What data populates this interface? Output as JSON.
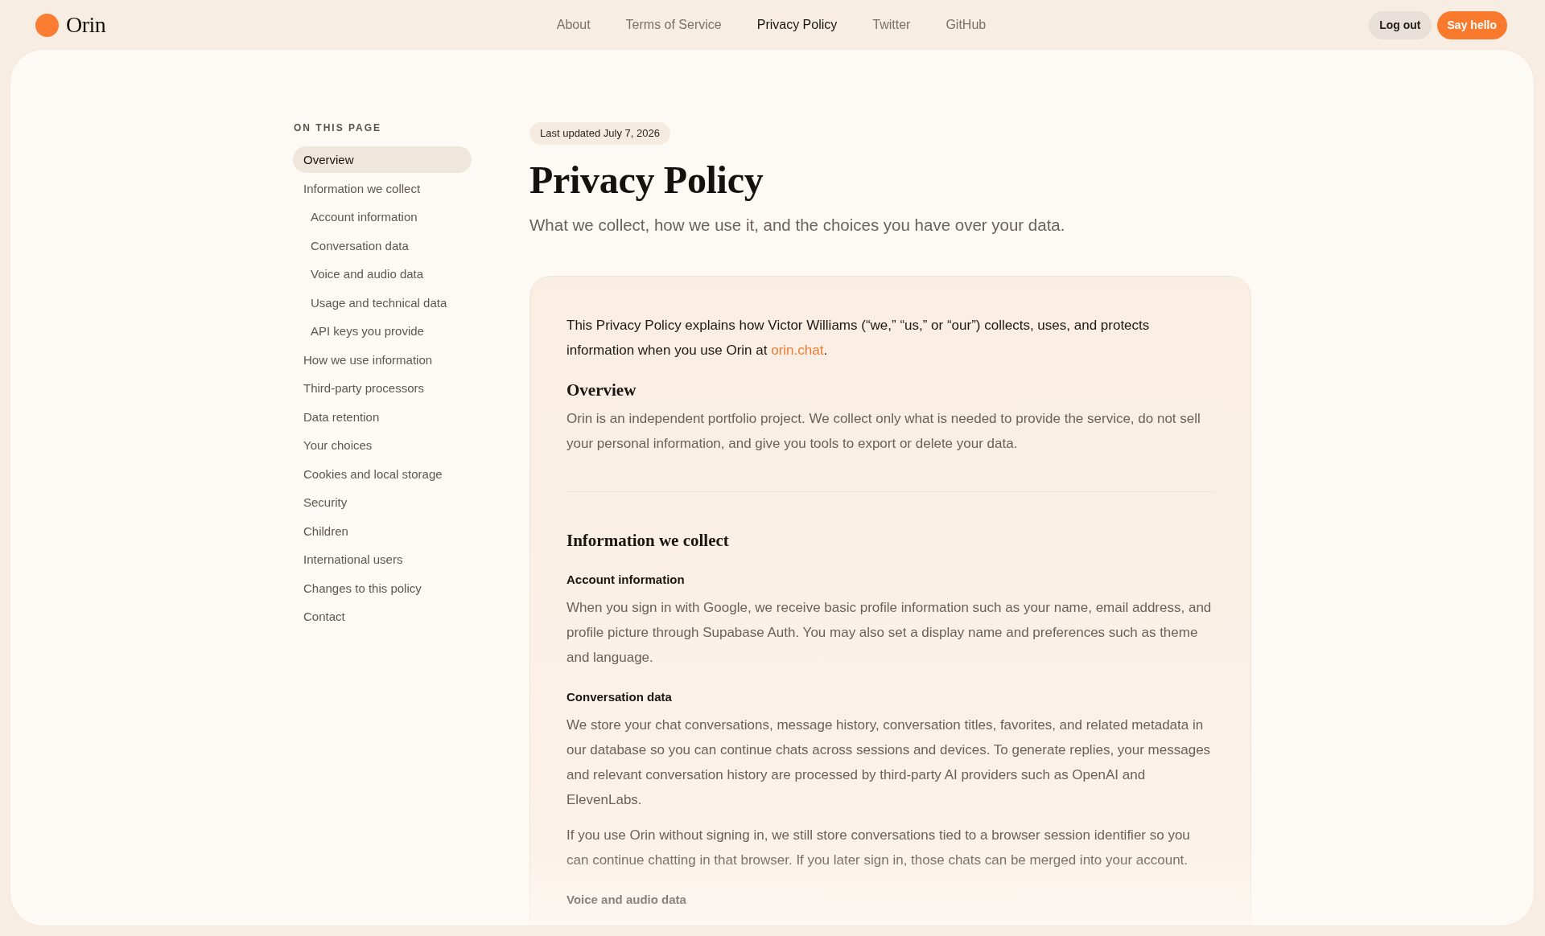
{
  "header": {
    "brand": "Orin",
    "nav": [
      {
        "label": "About",
        "selected": false
      },
      {
        "label": "Terms of Service",
        "selected": false
      },
      {
        "label": "Privacy Policy",
        "selected": true
      },
      {
        "label": "Twitter",
        "selected": false
      },
      {
        "label": "GitHub",
        "selected": false
      }
    ],
    "buttons": [
      {
        "label": "Log out",
        "kind": "secondary"
      },
      {
        "label": "Say hello",
        "kind": "primary"
      }
    ]
  },
  "toc": {
    "title": "ON THIS PAGE",
    "items": [
      {
        "label": "Overview",
        "selected": true
      },
      {
        "label": "Information we collect",
        "selected": false,
        "children": [
          {
            "label": "Account information",
            "selected": false
          },
          {
            "label": "Conversation data",
            "selected": false
          },
          {
            "label": "Voice and audio data",
            "selected": false
          },
          {
            "label": "Usage and technical data",
            "selected": false
          },
          {
            "label": "API keys you provide",
            "selected": false
          }
        ]
      },
      {
        "label": "How we use information",
        "selected": false
      },
      {
        "label": "Third-party processors",
        "selected": false
      },
      {
        "label": "Data retention",
        "selected": false
      },
      {
        "label": "Your choices",
        "selected": false
      },
      {
        "label": "Cookies and local storage",
        "selected": false
      },
      {
        "label": "Security",
        "selected": false
      },
      {
        "label": "Children",
        "selected": false
      },
      {
        "label": "International users",
        "selected": false
      },
      {
        "label": "Changes to this policy",
        "selected": false
      },
      {
        "label": "Contact",
        "selected": false
      }
    ]
  },
  "page": {
    "badge": "Last updated July 7, 2026",
    "title": "Privacy Policy",
    "subtitle": "What we collect, how we use it, and the choices you have over your data."
  },
  "card": {
    "intro": {
      "text": "This Privacy Policy explains how Victor Williams (“we,” “us,” or “our”) collects, uses, and protects information when you use Orin at ",
      "link": "orin.chat",
      "after": "."
    },
    "sections": [
      {
        "heading": "Overview",
        "blocks": [
          {
            "kind": "paragraph",
            "text": "Orin is an independent portfolio project. We collect only what is needed to provide the service, do not sell your personal information, and give you tools to export or delete your data."
          }
        ]
      },
      {
        "heading": "Information we collect",
        "blocks": [
          {
            "kind": "subheading",
            "text": "Account information"
          },
          {
            "kind": "paragraph",
            "text": "When you sign in with Google, we receive basic profile information such as your name, email address, and profile picture through Supabase Auth. You may also set a display name and preferences such as theme and language."
          },
          {
            "kind": "subheading",
            "text": "Conversation data"
          },
          {
            "kind": "paragraph",
            "text": "We store your chat conversations, message history, conversation titles, favorites, and related metadata in our database so you can continue chats across sessions and devices. To generate replies, your messages and relevant conversation history are processed by third-party AI providers such as OpenAI and ElevenLabs."
          },
          {
            "kind": "paragraph",
            "text": "If you use Orin without signing in, we still store conversations tied to a browser session identifier so you can continue chatting in that browser. If you later sign in, those chats can be merged into your account."
          },
          {
            "kind": "subheading",
            "text": "Voice and audio data"
          }
        ]
      }
    ]
  }
}
